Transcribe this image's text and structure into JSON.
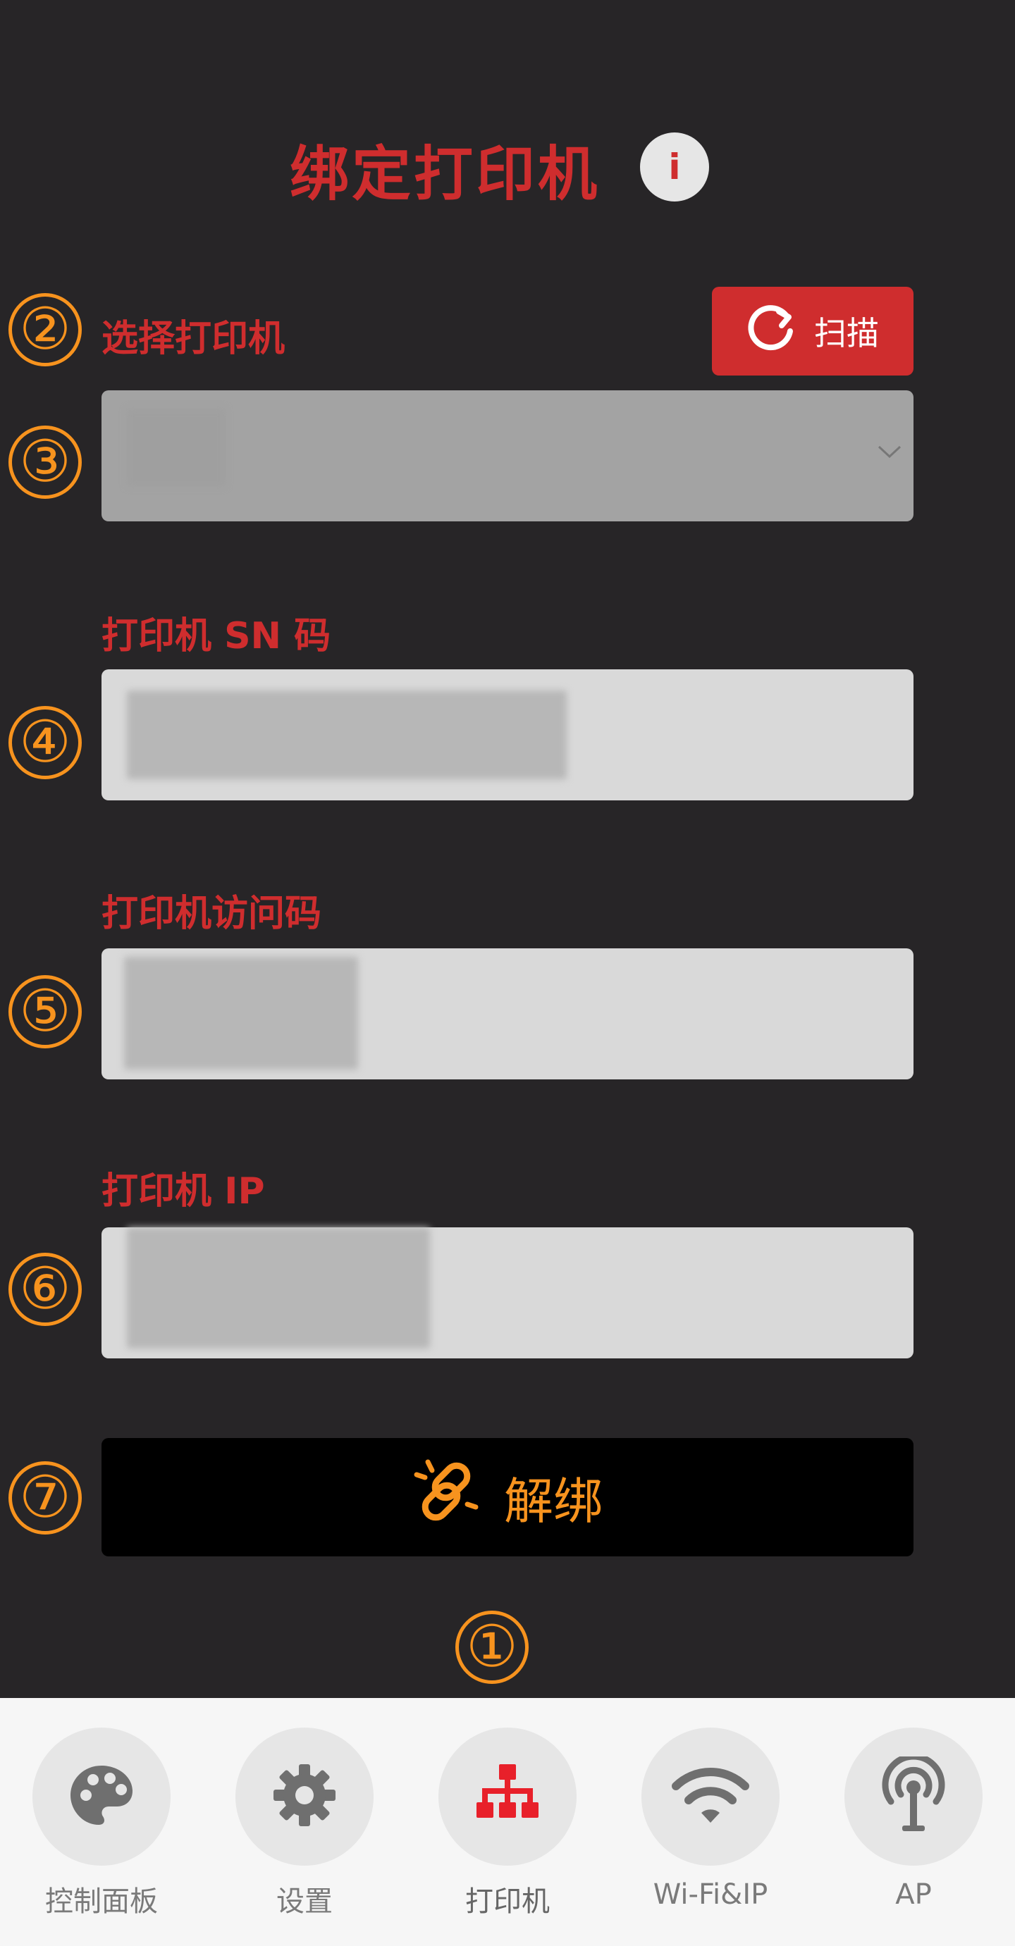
{
  "header": {
    "title": "绑定打印机",
    "info_label": "i"
  },
  "markers": {
    "m1": "①",
    "m2": "②",
    "m3": "③",
    "m4": "④",
    "m5": "⑤",
    "m6": "⑥",
    "m7": "⑦"
  },
  "printer_select": {
    "label": "选择打印机",
    "scan_label": "扫描"
  },
  "sn_field": {
    "label": "打印机 SN 码"
  },
  "access_code_field": {
    "label": "打印机访问码"
  },
  "ip_field": {
    "label": "打印机 IP"
  },
  "unbind_button": {
    "label": "解绑"
  },
  "nav": {
    "items": [
      {
        "label": "控制面板",
        "icon": "palette-icon"
      },
      {
        "label": "设置",
        "icon": "gear-icon"
      },
      {
        "label": "打印机",
        "icon": "printer-network-icon",
        "active": true
      },
      {
        "label": "Wi-Fi&IP",
        "icon": "wifi-icon"
      },
      {
        "label": "AP",
        "icon": "antenna-icon"
      }
    ]
  },
  "colors": {
    "accent": "#cf2d2e",
    "marker": "#f7931e",
    "background": "#272527"
  }
}
